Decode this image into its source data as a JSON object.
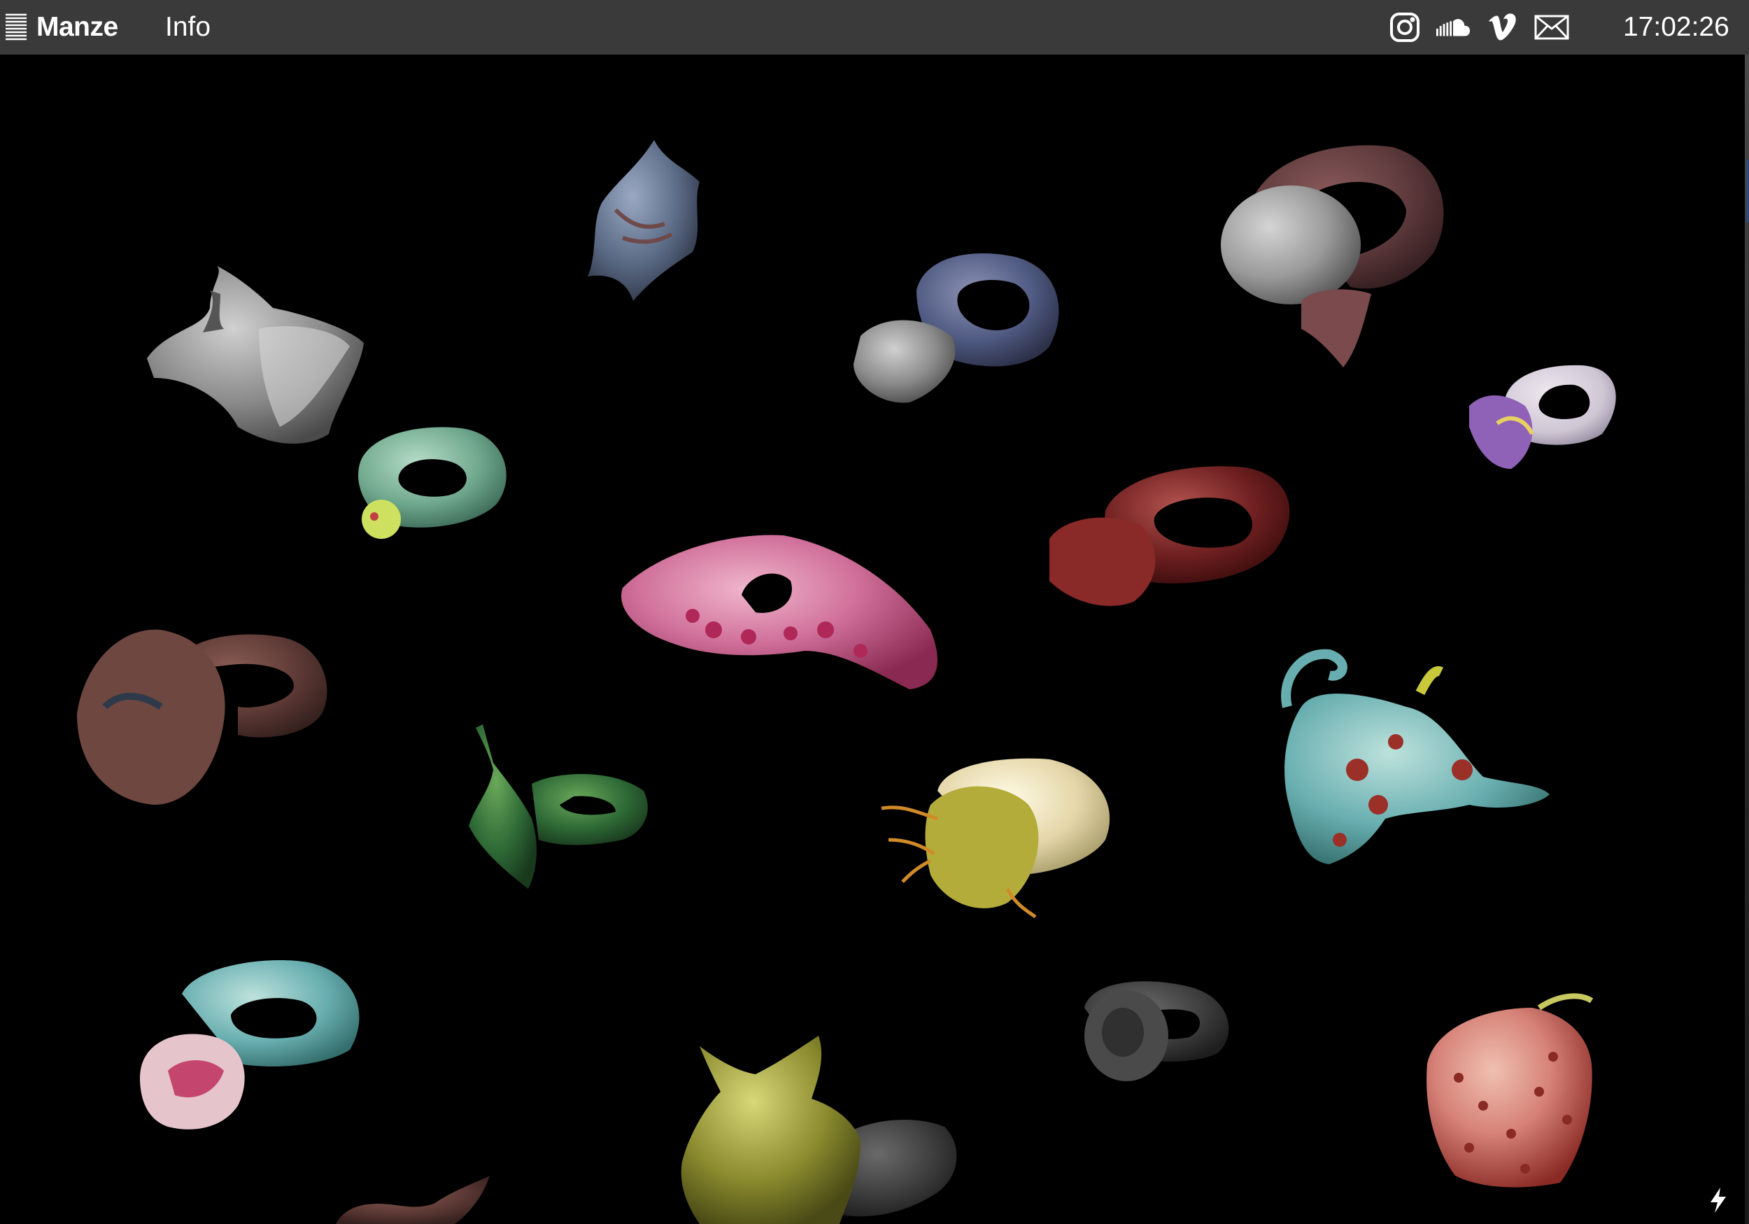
{
  "header": {
    "brand": "Manze",
    "nav_info": "Info",
    "clock": "17:02:26",
    "icons": [
      "menu-icon",
      "instagram-icon",
      "soundcloud-icon",
      "vimeo-icon",
      "mail-icon"
    ]
  },
  "gallery": {
    "items": [
      {
        "name": "grey-ruffled-ring",
        "colors": [
          "#8a8a8a",
          "#d0d0d0",
          "#4a4a4a"
        ]
      },
      {
        "name": "blue-spiky-ring",
        "colors": [
          "#5a6a84",
          "#9aa8c4",
          "#2e3446"
        ]
      },
      {
        "name": "navy-knot-ring",
        "colors": [
          "#4f5a82",
          "#8c92b4",
          "#2c3048"
        ]
      },
      {
        "name": "grey-bulb-maroon-ring",
        "colors": [
          "#5e3a3c",
          "#9a9a9a",
          "#d4d4d4"
        ]
      },
      {
        "name": "lavender-ring",
        "colors": [
          "#cfc6d4",
          "#eee8f0",
          "#8f62b8"
        ]
      },
      {
        "name": "mint-ring",
        "colors": [
          "#6fa88e",
          "#b6dcc6",
          "#cde060"
        ]
      },
      {
        "name": "pink-tentacle-ring",
        "colors": [
          "#c04a78",
          "#f0b6cc",
          "#e8dce2"
        ]
      },
      {
        "name": "crimson-ring",
        "colors": [
          "#6e1f20",
          "#a4403e",
          "#3a0c0c"
        ]
      },
      {
        "name": "rust-knotted-ring",
        "colors": [
          "#5e3a36",
          "#8a5e54",
          "#36211e"
        ]
      },
      {
        "name": "green-leaf-ring",
        "colors": [
          "#2e6a36",
          "#6aa85a",
          "#1a3a1e"
        ]
      },
      {
        "name": "yellow-noodle-ring",
        "colors": [
          "#e4d6a8",
          "#fffbe6",
          "#b4ac3a"
        ]
      },
      {
        "name": "teal-octopus-ring",
        "colors": [
          "#68aeb0",
          "#bde2dc",
          "#9a3028"
        ]
      },
      {
        "name": "teal-pink-flower-ring",
        "colors": [
          "#6ea6a4",
          "#d8ecec",
          "#c4466e"
        ]
      },
      {
        "name": "olive-spiky-ring",
        "colors": [
          "#8a8a2e",
          "#c8c86a",
          "#3a3a3a"
        ]
      },
      {
        "name": "dark-grey-ring",
        "colors": [
          "#3e3e3e",
          "#6a6a6a",
          "#1e1e1e"
        ]
      },
      {
        "name": "coral-textured-ring",
        "colors": [
          "#d68278",
          "#f0c0b0",
          "#8a2a24"
        ]
      },
      {
        "name": "partial-brown-ring",
        "colors": [
          "#4a2a28",
          "#6e3e3a",
          "#2a1614"
        ]
      }
    ]
  },
  "footer": {
    "icon": "lightning-icon"
  }
}
